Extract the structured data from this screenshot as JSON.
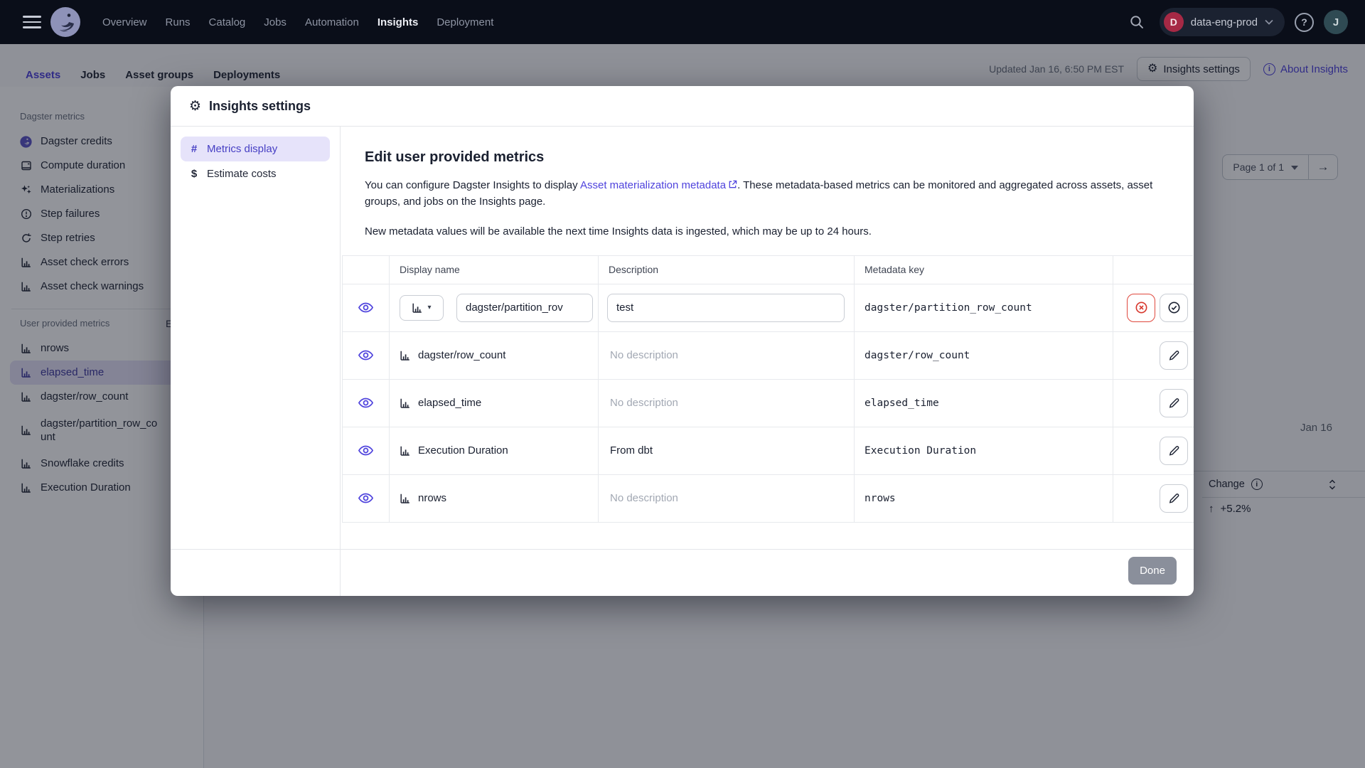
{
  "topnav": {
    "items": [
      "Overview",
      "Runs",
      "Catalog",
      "Jobs",
      "Automation",
      "Insights",
      "Deployment"
    ],
    "active_item": "Insights",
    "workspace": {
      "initial": "D",
      "name": "data-eng-prod"
    },
    "help_glyph": "?",
    "avatar_initial": "J"
  },
  "subnav": {
    "tabs": [
      "Assets",
      "Jobs",
      "Asset groups",
      "Deployments"
    ],
    "active_tab": "Assets",
    "updated": "Updated Jan 16, 6:50 PM EST",
    "settings_button": "Insights settings",
    "about_link": "About Insights"
  },
  "sidebar": {
    "dagster_section": {
      "title": "Dagster metrics",
      "items": [
        "Dagster credits",
        "Compute duration",
        "Materializations",
        "Step failures",
        "Step retries",
        "Asset check errors",
        "Asset check warnings"
      ]
    },
    "user_section": {
      "title": "User provided metrics",
      "edit_link_clipped": "E",
      "items": [
        "nrows",
        "elapsed_time",
        "dagster/row_count",
        "dagster/partition_row_count",
        "Snowflake credits",
        "Execution Duration"
      ],
      "selected": "elapsed_time"
    }
  },
  "modal": {
    "title": "Insights settings",
    "nav": {
      "metrics_display": "Metrics display",
      "metrics_display_glyph": "#",
      "estimate_costs": "Estimate costs",
      "estimate_costs_glyph": "$",
      "active": "Metrics display"
    },
    "heading": "Edit user provided metrics",
    "intro": {
      "before": "You can configure Dagster Insights to display ",
      "link": "Asset materialization metadata",
      "after": ". These metadata-based metrics can be monitored and aggregated across assets, asset groups, and jobs on the Insights page."
    },
    "note": "New metadata values will be available the next time Insights data is ingested, which may be up to 24 hours.",
    "table": {
      "headers": {
        "display_name": "Display name",
        "description": "Description",
        "metadata_key": "Metadata key"
      },
      "editing_row": {
        "display_name_value": "dagster/partition_rov",
        "description_value": "test",
        "metadata_key": "dagster/partition_row_count"
      },
      "rows": [
        {
          "display_name": "dagster/row_count",
          "description": "No description",
          "description_is_placeholder": true,
          "metadata_key": "dagster/row_count"
        },
        {
          "display_name": "elapsed_time",
          "description": "No description",
          "description_is_placeholder": true,
          "metadata_key": "elapsed_time"
        },
        {
          "display_name": "Execution Duration",
          "description": "From dbt",
          "description_is_placeholder": false,
          "metadata_key": "Execution Duration"
        },
        {
          "display_name": "nrows",
          "description": "No description",
          "description_is_placeholder": true,
          "metadata_key": "nrows"
        }
      ]
    },
    "done_button": "Done"
  },
  "background": {
    "pagination": "Page 1 of 1",
    "date_tick": "Jan 16",
    "change_column": {
      "header": "Change",
      "value": "+5.2%",
      "direction": "up"
    }
  },
  "colors": {
    "accent": "#4F43DD",
    "danger": "#D7372C",
    "topnav_bg": "#0A0E19",
    "done_button_bg": "#8A8F9B"
  }
}
